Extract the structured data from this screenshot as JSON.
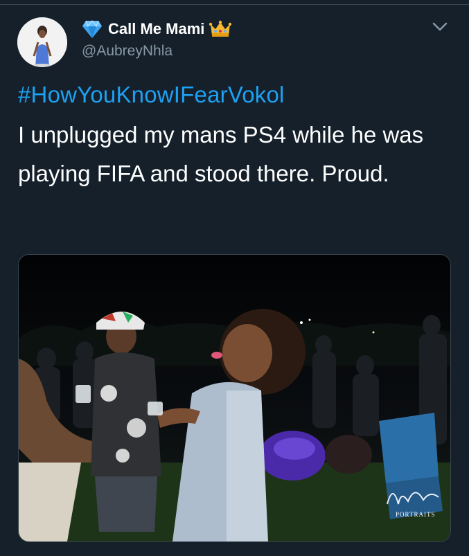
{
  "tweet": {
    "author": {
      "display_name": "Call Me Mami",
      "handle": "@AubreyNhla",
      "badge_left_icon": "diamond-icon",
      "badge_right_icon": "crown-icon"
    },
    "hashtag": "#HowYouKnowIFearVokol",
    "text": "I unplugged my mans PS4 while he was playing FIFA and stood there. Proud.",
    "media": {
      "watermark_line1": "PORTRAITS"
    }
  },
  "colors": {
    "background": "#15202b",
    "hashtag": "#1da1f2",
    "secondary_text": "#8899a6",
    "diamond": "#3ba4f0",
    "crown": "#f5b82e"
  }
}
